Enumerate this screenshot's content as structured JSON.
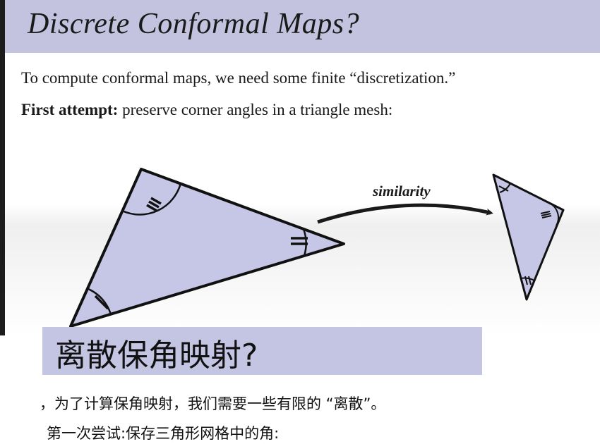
{
  "slide": {
    "title": "Discrete Conformal Maps?",
    "line1": "To compute conformal maps, we need some finite “discretization.”",
    "line2_bold": "First attempt:",
    "line2_rest": " preserve corner angles in a triangle mesh:"
  },
  "figure": {
    "arrow_label": "similarity"
  },
  "translation": {
    "title": "离散保角映射?",
    "line1": "，为了计算保角映射，我们需要一些有限的 “离散”。",
    "line2": "第一次尝试:保存三角形网格中的角:"
  },
  "colors": {
    "title_bar": "#c3c3e0",
    "triangle_fill": "#c6c6e6",
    "translation_box": "#c4c4e3"
  }
}
